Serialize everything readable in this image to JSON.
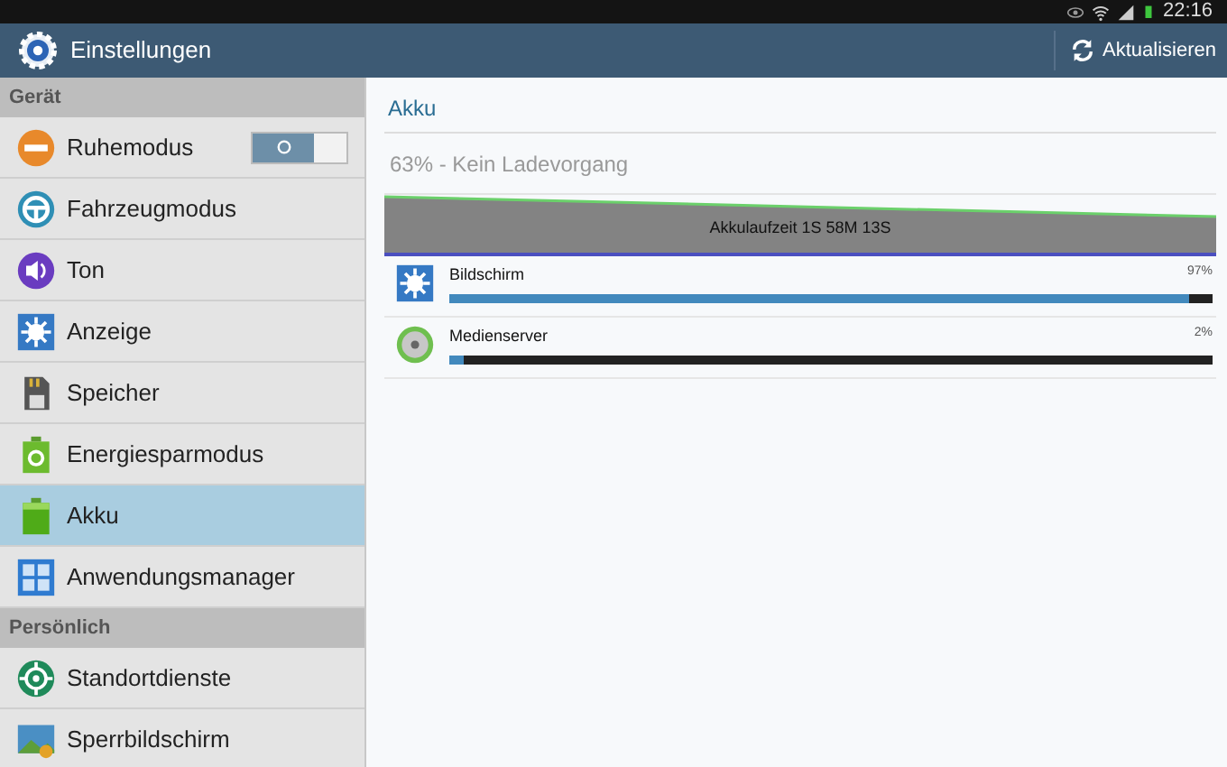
{
  "status_bar": {
    "time": "22:16"
  },
  "action_bar": {
    "title": "Einstellungen",
    "refresh_button": "Aktualisieren"
  },
  "sidebar": {
    "items": [
      {
        "kind": "header",
        "label": "Gerät"
      },
      {
        "kind": "item",
        "label": "Ruhemodus",
        "selected": false,
        "toggle": {
          "on": false
        }
      },
      {
        "kind": "item",
        "label": "Fahrzeugmodus",
        "selected": false
      },
      {
        "kind": "item",
        "label": "Ton",
        "selected": false
      },
      {
        "kind": "item",
        "label": "Anzeige",
        "selected": false
      },
      {
        "kind": "item",
        "label": "Speicher",
        "selected": false
      },
      {
        "kind": "item",
        "label": "Energiesparmodus",
        "selected": false
      },
      {
        "kind": "item",
        "label": "Akku",
        "selected": true
      },
      {
        "kind": "item",
        "label": "Anwendungsmanager",
        "selected": false
      },
      {
        "kind": "header",
        "label": "Persönlich"
      },
      {
        "kind": "item",
        "label": "Standortdienste",
        "selected": false
      },
      {
        "kind": "item",
        "label": "Sperrbildschirm",
        "selected": false
      }
    ]
  },
  "content": {
    "title": "Akku",
    "charge_status": "63% - Kein Ladevorgang",
    "battery_time": "Akkulaufzeit 1S 58M 13S",
    "usage": [
      {
        "name": "Bildschirm",
        "percent": "97%",
        "level": 0.97
      },
      {
        "name": "Medienserver",
        "percent": "2%",
        "level": 0.02
      }
    ]
  }
}
